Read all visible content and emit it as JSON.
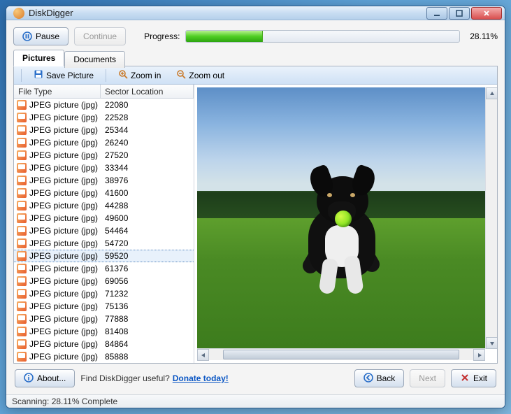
{
  "window": {
    "title": "DiskDigger"
  },
  "toolbar_top": {
    "pause_label": "Pause",
    "continue_label": "Continue",
    "progress_label": "Progress:",
    "progress_percent": "28.11%",
    "progress_fill_width": "28.11%"
  },
  "tabs": {
    "pictures": "Pictures",
    "documents": "Documents"
  },
  "panel_toolbar": {
    "save_label": "Save Picture",
    "zoom_in_label": "Zoom in",
    "zoom_out_label": "Zoom out"
  },
  "columns": {
    "file_type": "File Type",
    "sector": "Sector Location"
  },
  "rows": [
    {
      "type": "JPEG picture (jpg)",
      "sector": "22080",
      "selected": false
    },
    {
      "type": "JPEG picture (jpg)",
      "sector": "22528",
      "selected": false
    },
    {
      "type": "JPEG picture (jpg)",
      "sector": "25344",
      "selected": false
    },
    {
      "type": "JPEG picture (jpg)",
      "sector": "26240",
      "selected": false
    },
    {
      "type": "JPEG picture (jpg)",
      "sector": "27520",
      "selected": false
    },
    {
      "type": "JPEG picture (jpg)",
      "sector": "33344",
      "selected": false
    },
    {
      "type": "JPEG picture (jpg)",
      "sector": "38976",
      "selected": false
    },
    {
      "type": "JPEG picture (jpg)",
      "sector": "41600",
      "selected": false
    },
    {
      "type": "JPEG picture (jpg)",
      "sector": "44288",
      "selected": false
    },
    {
      "type": "JPEG picture (jpg)",
      "sector": "49600",
      "selected": false
    },
    {
      "type": "JPEG picture (jpg)",
      "sector": "54464",
      "selected": false
    },
    {
      "type": "JPEG picture (jpg)",
      "sector": "54720",
      "selected": false
    },
    {
      "type": "JPEG picture (jpg)",
      "sector": "59520",
      "selected": true
    },
    {
      "type": "JPEG picture (jpg)",
      "sector": "61376",
      "selected": false
    },
    {
      "type": "JPEG picture (jpg)",
      "sector": "69056",
      "selected": false
    },
    {
      "type": "JPEG picture (jpg)",
      "sector": "71232",
      "selected": false
    },
    {
      "type": "JPEG picture (jpg)",
      "sector": "75136",
      "selected": false
    },
    {
      "type": "JPEG picture (jpg)",
      "sector": "77888",
      "selected": false
    },
    {
      "type": "JPEG picture (jpg)",
      "sector": "81408",
      "selected": false
    },
    {
      "type": "JPEG picture (jpg)",
      "sector": "84864",
      "selected": false
    },
    {
      "type": "JPEG picture (jpg)",
      "sector": "85888",
      "selected": false
    }
  ],
  "footer": {
    "about_label": "About...",
    "useful_text": "Find DiskDigger useful?",
    "donate_link": "Donate today!",
    "back_label": "Back",
    "next_label": "Next",
    "exit_label": "Exit"
  },
  "statusbar": {
    "text": "Scanning: 28.11% Complete"
  }
}
